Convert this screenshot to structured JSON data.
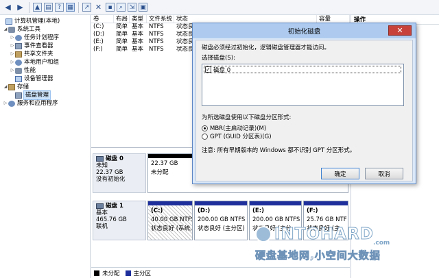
{
  "tree": {
    "root": "计算机管理(本地)",
    "system_tools": "系统工具",
    "task_scheduler": "任务计划程序",
    "event_viewer": "事件查看器",
    "shared_folders": "共享文件夹",
    "local_users": "本地用户和组",
    "performance": "性能",
    "device_manager": "设备管理器",
    "storage": "存储",
    "disk_management": "磁盘管理",
    "services_apps": "服务和应用程序"
  },
  "volume_list": {
    "headers": [
      "卷",
      "布局",
      "类型",
      "文件系统",
      "状态",
      "容量"
    ],
    "rows": [
      [
        "(C:)",
        "简单",
        "基本",
        "NTFS",
        "状态良"
      ],
      [
        "(D:)",
        "简单",
        "基本",
        "NTFS",
        "状态良"
      ],
      [
        "(E:)",
        "简单",
        "基本",
        "NTFS",
        "状态良"
      ],
      [
        "(F:)",
        "简单",
        "基本",
        "NTFS",
        "状态良"
      ]
    ]
  },
  "actions": {
    "title": "操作"
  },
  "disks": {
    "disk0": {
      "name": "磁盘 0",
      "status": "未知",
      "size": "22.37 GB",
      "init": "没有初始化",
      "part_size": "22.37 GB",
      "part_status": "未分配"
    },
    "disk1": {
      "name": "磁盘 1",
      "type": "基本",
      "size": "465.76 GB",
      "state": "联机",
      "parts": [
        {
          "label": "(C:)",
          "size": "40.00 GB NTFS",
          "status": "状态良好 (系统,"
        },
        {
          "label": "(D:)",
          "size": "200.00 GB NTFS",
          "status": "状态良好 (主分区)"
        },
        {
          "label": "(E:)",
          "size": "200.00 GB NTFS",
          "status": "状态良好 (主分"
        },
        {
          "label": "(F:)",
          "size": "25.76 GB NTF",
          "status": "状态良好 (主"
        }
      ]
    }
  },
  "legend": {
    "unallocated": "未分配",
    "primary": "主分区"
  },
  "dialog": {
    "title": "初始化磁盘",
    "message": "磁盘必须经过初始化，逻辑磁盘管理器才能访问。",
    "select_label": "选择磁盘(S):",
    "disk_item": "磁盘 0",
    "style_label": "为所选磁盘使用以下磁盘分区形式:",
    "mbr": "MBR(主启动记录)(M)",
    "gpt": "GPT (GUID 分区表)(G)",
    "note": "注意: 所有早期版本的 Windows 都不识别 GPT 分区形式。",
    "ok": "确定",
    "cancel": "取消",
    "close": "✕"
  },
  "watermark": {
    "main": "INTOHARD",
    "com": ".com",
    "sub": "硬盘基地网,小空间大数据"
  },
  "colors": {
    "primary_partition": "#1e2f9c",
    "unallocated": "#000000",
    "dialog_title": "#aecbef",
    "close_button": "#c7423a"
  }
}
